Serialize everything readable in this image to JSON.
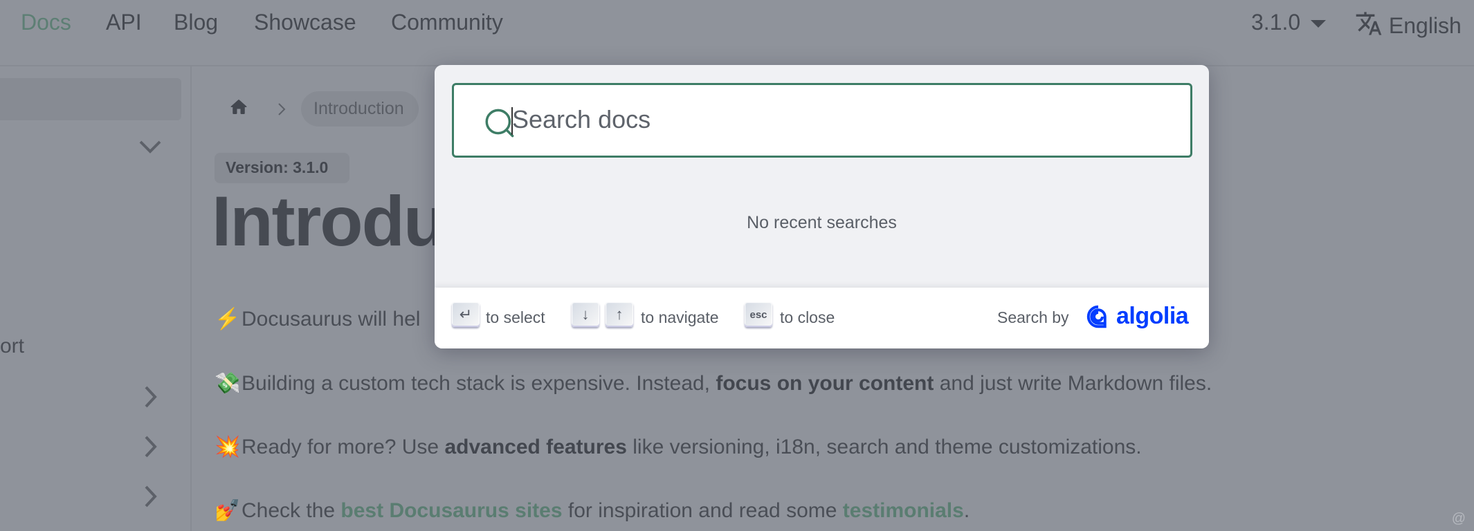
{
  "navbar": {
    "items": [
      {
        "label": "Docs",
        "active": true
      },
      {
        "label": "API"
      },
      {
        "label": "Blog"
      },
      {
        "label": "Showcase"
      },
      {
        "label": "Community"
      }
    ],
    "version": "3.1.0",
    "language": "English"
  },
  "sidebar": {
    "partial_item": "ort"
  },
  "breadcrumb": {
    "home_icon": "home-icon",
    "current": "Introduction"
  },
  "doc": {
    "version_badge": "Version: 3.1.0",
    "title_visible": "Introdu",
    "paragraphs": [
      {
        "emoji": "⚡",
        "text": "Docusaurus will hel"
      },
      {
        "emoji": "💸",
        "pre": "Building a custom tech stack is expensive. Instead, ",
        "bold": "focus on your content",
        "post": " and just write Markdown files."
      },
      {
        "emoji": "💥",
        "pre": "Ready for more? Use ",
        "bold": "advanced features",
        "post": " like versioning, i18n, search and theme customizations."
      },
      {
        "emoji": "💅",
        "pre": "Check the ",
        "link1": "best Docusaurus sites",
        "mid": " for inspiration and read some ",
        "link2": "testimonials",
        "post": "."
      }
    ]
  },
  "search_modal": {
    "placeholder": "Search docs",
    "value": "",
    "empty_state": "No recent searches",
    "footer": {
      "enter_key": "↵",
      "select_label": "to select",
      "down_key": "↓",
      "up_key": "↑",
      "navigate_label": "to navigate",
      "esc_key": "esc",
      "close_label": "to close",
      "search_by": "Search by",
      "brand": "algolia"
    }
  },
  "colors": {
    "accent_green": "#3e7d66",
    "algolia_blue": "#003dff"
  },
  "watermark": "@稀土掘金技术社区"
}
